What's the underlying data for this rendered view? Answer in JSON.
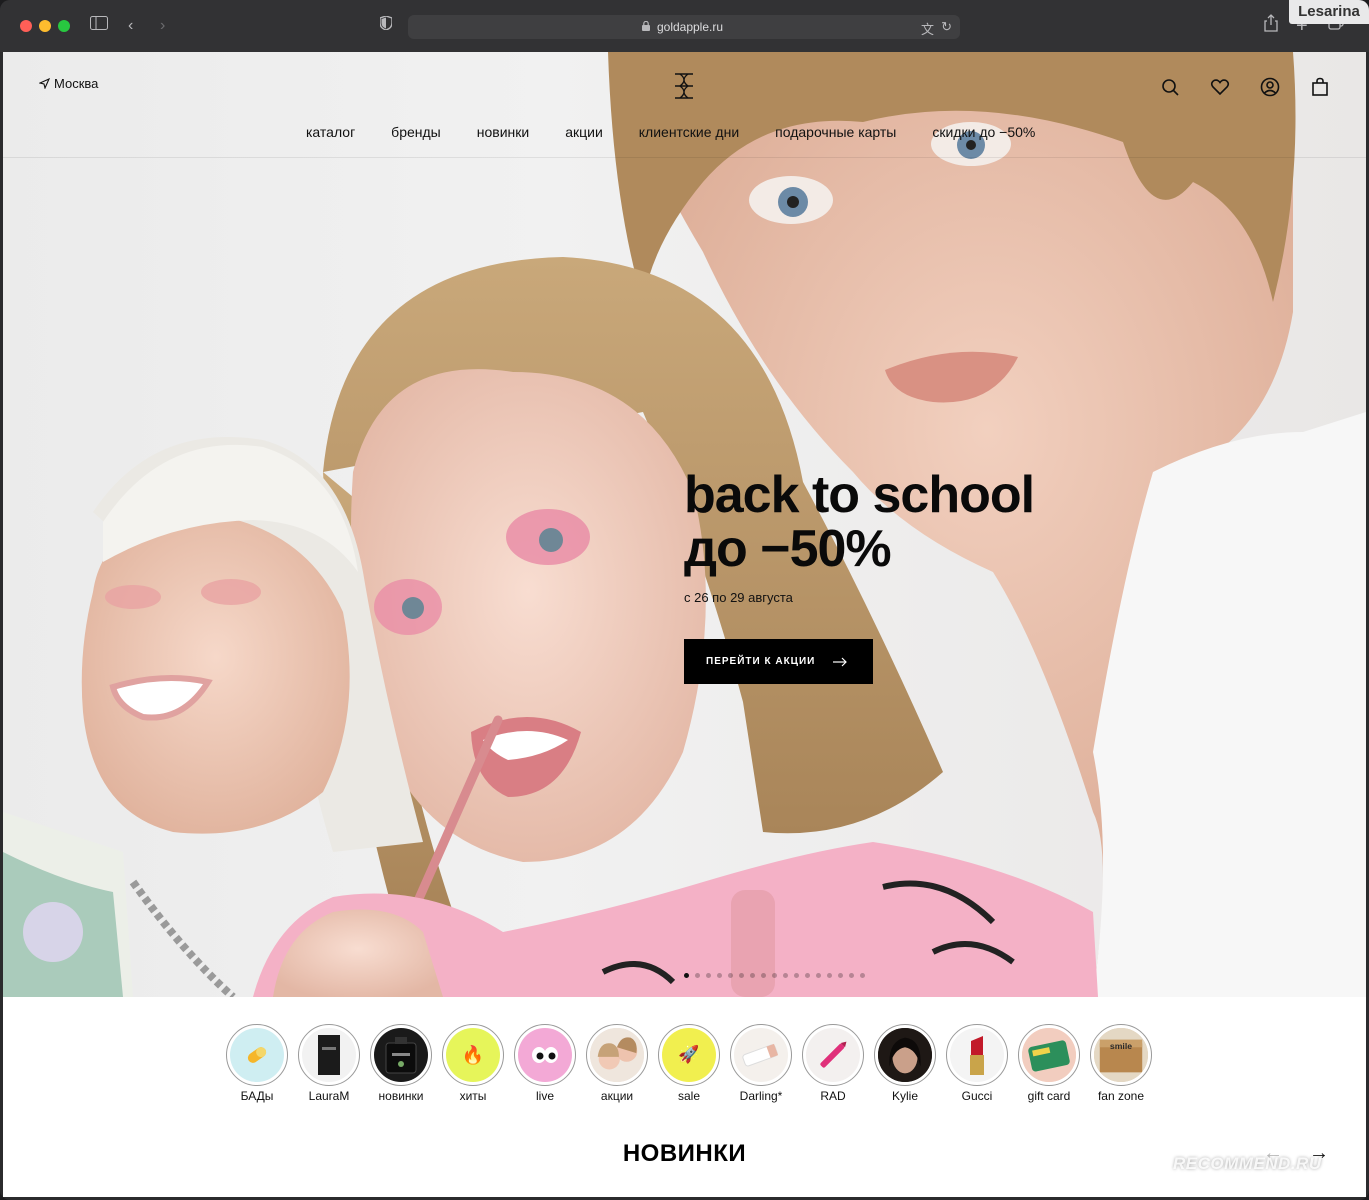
{
  "browser": {
    "url": "goldapple.ru",
    "watermark_user": "Lesarina"
  },
  "header": {
    "city": "Москва",
    "nav": [
      "каталог",
      "бренды",
      "новинки",
      "акции",
      "клиентские дни",
      "подарочные карты",
      "скидки до −50%"
    ]
  },
  "promo": {
    "title_line1": "back to school",
    "title_line2": "до −50%",
    "subtitle": "с 26 по 29 августа",
    "button": "ПЕРЕЙТИ К АКЦИИ"
  },
  "slider": {
    "total": 17,
    "active": 1
  },
  "stories": [
    {
      "label": "БАДы",
      "bg": "#cfeef2",
      "icon": "pill-icon"
    },
    {
      "label": "LauraM",
      "bg": "#f2f2f2",
      "icon": "foundation-bottle-icon"
    },
    {
      "label": "новинки",
      "bg": "#1a1a1a",
      "icon": "perfume-bottle-icon"
    },
    {
      "label": "хиты",
      "bg": "#e6f55a",
      "icon": "fire-icon"
    },
    {
      "label": "live",
      "bg": "#f3a9d6",
      "icon": "eyes-icon"
    },
    {
      "label": "акции",
      "bg": "#e8dcd2",
      "icon": "models-photo-icon"
    },
    {
      "label": "sale",
      "bg": "#f1ef4f",
      "icon": "rocket-icon"
    },
    {
      "label": "Darling*",
      "bg": "#f4f0ec",
      "icon": "tube-icon"
    },
    {
      "label": "RAD",
      "bg": "#f3f0ef",
      "icon": "lip-liner-icon"
    },
    {
      "label": "Kylie",
      "bg": "#2a2320",
      "icon": "kylie-portrait-icon"
    },
    {
      "label": "Gucci",
      "bg": "#f4f4f4",
      "icon": "lipstick-icon"
    },
    {
      "label": "gift card",
      "bg": "#f5d4c9",
      "icon": "gift-card-icon"
    },
    {
      "label": "fan zone",
      "bg": "#d8c6a8",
      "icon": "smile-box-icon"
    }
  ],
  "section": {
    "title": "НОВИНКИ"
  },
  "footer_watermark": "RECOMMEND.RU"
}
